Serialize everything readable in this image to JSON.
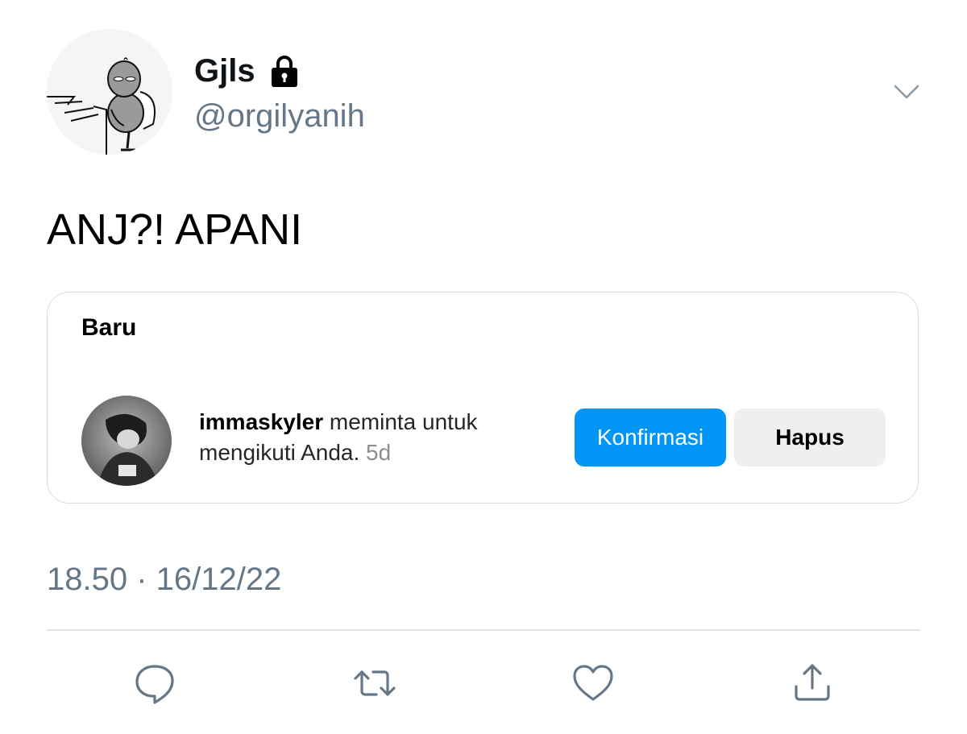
{
  "header": {
    "display_name": "Gjls",
    "handle": "@orgilyanih",
    "protected_icon": "lock-icon",
    "menu_icon": "chevron-down-icon"
  },
  "tweet": {
    "text": "ANJ?! APANI",
    "timestamp": "18.50 · 16/12/22"
  },
  "embedded_card": {
    "title": "Baru",
    "request": {
      "username": "immaskyler",
      "message": "meminta untuk mengikuti Anda.",
      "time": "5d"
    },
    "confirm_label": "Konfirmasi",
    "delete_label": "Hapus"
  },
  "actions": {
    "reply_icon": "reply-icon",
    "retweet_icon": "retweet-icon",
    "like_icon": "heart-icon",
    "share_icon": "share-icon"
  },
  "colors": {
    "secondary_text": "#657786",
    "confirm_button": "#0095f6",
    "delete_button": "#efefef",
    "card_border": "#d6dce1"
  }
}
